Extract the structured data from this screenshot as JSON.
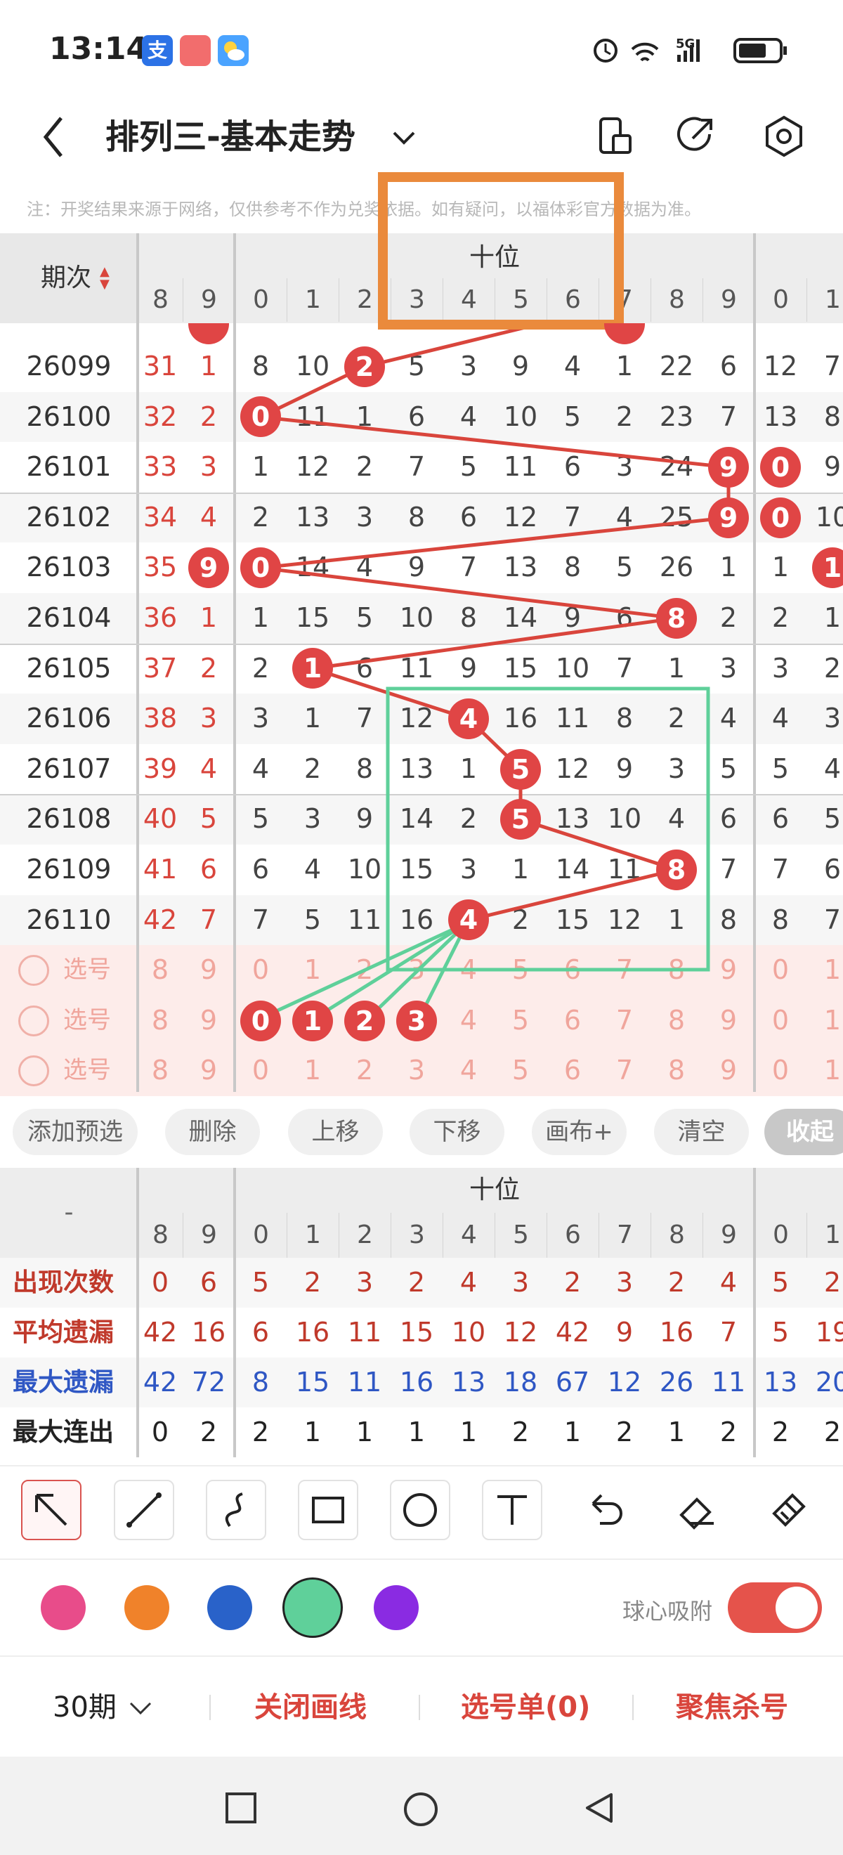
{
  "status": {
    "time": "13:14",
    "network": "5G",
    "apps": [
      "支",
      "",
      ""
    ]
  },
  "header": {
    "title": "排列三-基本走势"
  },
  "note": "注：开奖结果来源于网络，仅供参考不作为兑奖依据。如有疑问，以福体彩官方数据为准。",
  "table": {
    "issue_header": "期次",
    "group_label": "十位",
    "col_digits": [
      "8",
      "9",
      "0",
      "1",
      "2",
      "3",
      "4",
      "5",
      "6",
      "7",
      "8",
      "9",
      "0",
      "1"
    ],
    "rows": [
      {
        "issue": "26099",
        "cells": [
          "31",
          "1",
          "8",
          "10",
          "2",
          "5",
          "3",
          "9",
          "4",
          "1",
          "22",
          "6",
          "12",
          "7"
        ],
        "hit": [
          4
        ]
      },
      {
        "issue": "26100",
        "cells": [
          "32",
          "2",
          "0",
          "11",
          "1",
          "6",
          "4",
          "10",
          "5",
          "2",
          "23",
          "7",
          "13",
          "8"
        ],
        "hit": [
          2
        ]
      },
      {
        "issue": "26101",
        "cells": [
          "33",
          "3",
          "1",
          "12",
          "2",
          "7",
          "5",
          "11",
          "6",
          "3",
          "24",
          "9",
          "0",
          "9"
        ],
        "hit": [
          11,
          12
        ]
      },
      {
        "issue": "26102",
        "cells": [
          "34",
          "4",
          "2",
          "13",
          "3",
          "8",
          "6",
          "12",
          "7",
          "4",
          "25",
          "9",
          "0",
          "10"
        ],
        "hit": [
          11,
          12
        ]
      },
      {
        "issue": "26103",
        "cells": [
          "35",
          "9",
          "0",
          "14",
          "4",
          "9",
          "7",
          "13",
          "8",
          "5",
          "26",
          "1",
          "1",
          "1"
        ],
        "hit": [
          1,
          2,
          13
        ]
      },
      {
        "issue": "26104",
        "cells": [
          "36",
          "1",
          "1",
          "15",
          "5",
          "10",
          "8",
          "14",
          "9",
          "6",
          "8",
          "2",
          "2",
          "1"
        ],
        "hit": [
          10
        ]
      },
      {
        "issue": "26105",
        "cells": [
          "37",
          "2",
          "2",
          "1",
          "6",
          "11",
          "9",
          "15",
          "10",
          "7",
          "1",
          "3",
          "3",
          "2"
        ],
        "hit": [
          3
        ]
      },
      {
        "issue": "26106",
        "cells": [
          "38",
          "3",
          "3",
          "1",
          "7",
          "12",
          "4",
          "16",
          "11",
          "8",
          "2",
          "4",
          "4",
          "3"
        ],
        "hit": [
          6
        ]
      },
      {
        "issue": "26107",
        "cells": [
          "39",
          "4",
          "4",
          "2",
          "8",
          "13",
          "1",
          "5",
          "12",
          "9",
          "3",
          "5",
          "5",
          "4"
        ],
        "hit": [
          7
        ]
      },
      {
        "issue": "26108",
        "cells": [
          "40",
          "5",
          "5",
          "3",
          "9",
          "14",
          "2",
          "5",
          "13",
          "10",
          "4",
          "6",
          "6",
          "5"
        ],
        "hit": [
          7
        ]
      },
      {
        "issue": "26109",
        "cells": [
          "41",
          "6",
          "6",
          "4",
          "10",
          "15",
          "3",
          "1",
          "14",
          "11",
          "8",
          "7",
          "7",
          "6"
        ],
        "hit": [
          10
        ]
      },
      {
        "issue": "26110",
        "cells": [
          "42",
          "7",
          "7",
          "5",
          "11",
          "16",
          "4",
          "2",
          "15",
          "12",
          "1",
          "8",
          "8",
          "7"
        ],
        "hit": [
          6
        ]
      }
    ],
    "select_label": "选号",
    "select_rows": [
      {
        "cells": [
          "8",
          "9",
          "0",
          "1",
          "2",
          "3",
          "4",
          "5",
          "6",
          "7",
          "8",
          "9",
          "0",
          "1"
        ],
        "picked": []
      },
      {
        "cells": [
          "8",
          "9",
          "0",
          "1",
          "2",
          "3",
          "4",
          "5",
          "6",
          "7",
          "8",
          "9",
          "0",
          "1"
        ],
        "picked": [
          2,
          3,
          4,
          5
        ]
      },
      {
        "cells": [
          "8",
          "9",
          "0",
          "1",
          "2",
          "3",
          "4",
          "5",
          "6",
          "7",
          "8",
          "9",
          "0",
          "1"
        ],
        "picked": []
      }
    ]
  },
  "actions": [
    "添加预选",
    "删除",
    "上移",
    "下移",
    "画布+",
    "清空",
    "收起"
  ],
  "stats": {
    "corner": "-",
    "group_label": "十位",
    "col_digits": [
      "8",
      "9",
      "0",
      "1",
      "2",
      "3",
      "4",
      "5",
      "6",
      "7",
      "8",
      "9",
      "0",
      "1"
    ],
    "rows": [
      {
        "label": "出现次数",
        "color": "#c0392b",
        "values": [
          "0",
          "6",
          "5",
          "2",
          "3",
          "2",
          "4",
          "3",
          "2",
          "3",
          "2",
          "4",
          "5",
          "2"
        ]
      },
      {
        "label": "平均遗漏",
        "color": "#c0392b",
        "values": [
          "42",
          "16",
          "6",
          "16",
          "11",
          "15",
          "10",
          "12",
          "42",
          "9",
          "16",
          "7",
          "5",
          "19"
        ]
      },
      {
        "label": "最大遗漏",
        "color": "#2f57c4",
        "values": [
          "42",
          "72",
          "8",
          "15",
          "11",
          "16",
          "13",
          "18",
          "67",
          "12",
          "26",
          "11",
          "13",
          "20"
        ]
      },
      {
        "label": "最大连出",
        "color": "#222222",
        "values": [
          "0",
          "2",
          "2",
          "1",
          "1",
          "1",
          "1",
          "2",
          "1",
          "2",
          "1",
          "2",
          "2",
          "2"
        ]
      }
    ]
  },
  "tools": [
    "select-arrow",
    "line",
    "curve",
    "rectangle",
    "circle",
    "text",
    "undo",
    "eraser",
    "clear-brush"
  ],
  "colors": [
    "#e84c8a",
    "#f0822a",
    "#2962c9",
    "#5fd09a",
    "#8a2be2"
  ],
  "snap_label": "球心吸附",
  "snap_on": true,
  "bottom": {
    "period": "30期",
    "close_draw": "关闭画线",
    "pick_list": "选号单(0)",
    "focus_kill": "聚焦杀号"
  }
}
